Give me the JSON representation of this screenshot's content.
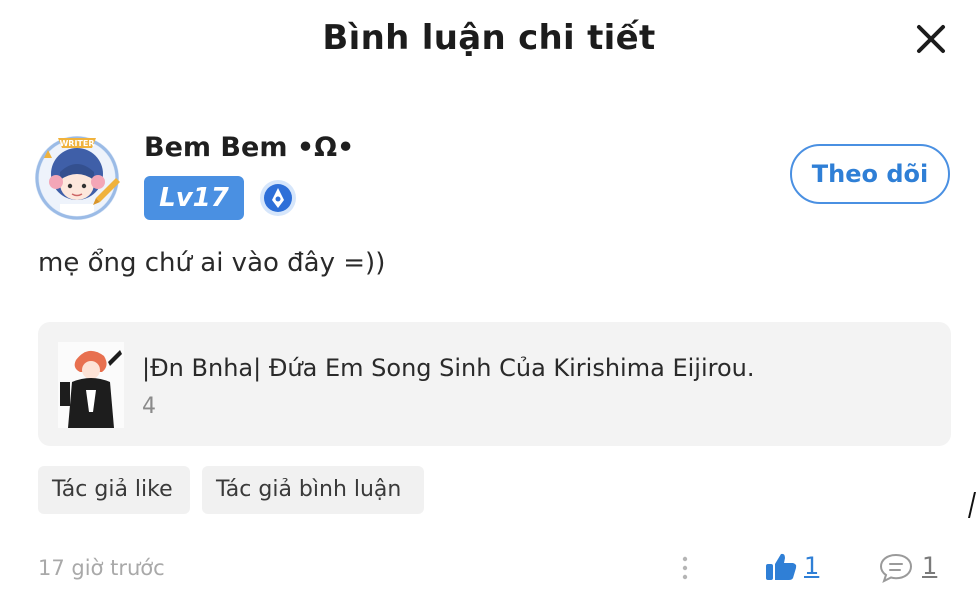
{
  "header": {
    "title": "Bình luận chi tiết"
  },
  "author": {
    "name": "Bem Bem •Ω•",
    "level": "Lv17",
    "follow_label": "Theo dõi",
    "avatar_badge": "WRITER"
  },
  "comment": {
    "text": "mẹ ổng chứ ai vào đây =))"
  },
  "story": {
    "title": "|Đn Bnha| Đứa Em Song Sinh Của Kirishima Eijirou.",
    "count": "4"
  },
  "tags": [
    {
      "label": "Tác giả like"
    },
    {
      "label": "Tác giả bình luận"
    }
  ],
  "footer": {
    "timestamp": "17 giờ trước",
    "like_count": "1",
    "reply_count": "1"
  },
  "colors": {
    "accent": "#4a90e2",
    "accent_text": "#2f7fd6",
    "card_bg": "#f3f3f3",
    "muted": "#a9a9a9"
  },
  "icons": {
    "close": "close-icon",
    "medal": "pen-medal-icon",
    "more": "more-vertical-icon",
    "like": "thumbs-up-icon",
    "reply": "comment-bubble-icon"
  }
}
